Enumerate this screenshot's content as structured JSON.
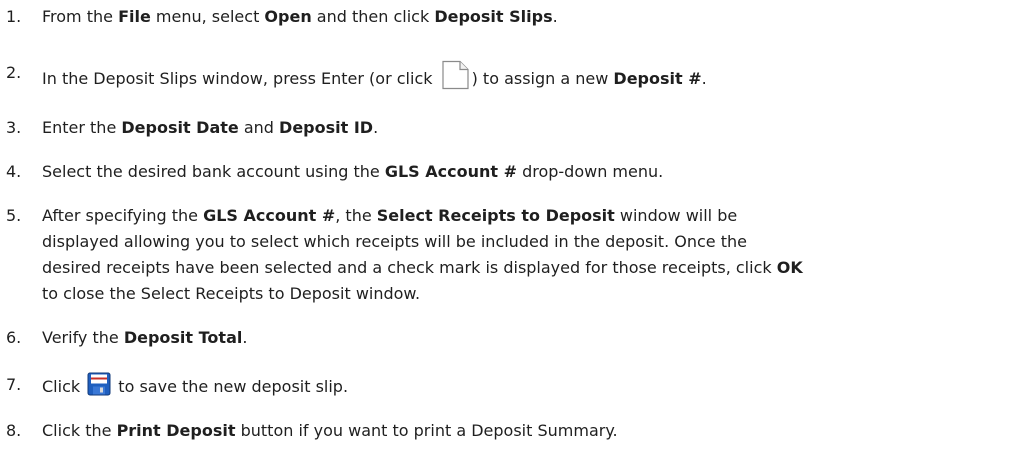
{
  "steps": [
    {
      "number": "1.",
      "t1": "From the ",
      "b1": "File",
      "t2": " menu, select ",
      "b2": "Open",
      "t3": " and then click ",
      "b3": "Deposit Slips",
      "t4": "."
    },
    {
      "number": "2.",
      "t1": "In the Deposit Slips window, press Enter (or click ",
      "icon": "new-document-icon",
      "t2": ") to assign a new ",
      "b1": "Deposit #",
      "t3": "."
    },
    {
      "number": "3.",
      "t1": "Enter the ",
      "b1": "Deposit Date",
      "t2": " and ",
      "b2": "Deposit ID",
      "t3": "."
    },
    {
      "number": "4.",
      "t1": "Select the desired bank account using the ",
      "b1": "GLS Account #",
      "t2": " drop-down menu."
    },
    {
      "number": "5.",
      "l1a": "After specifying the ",
      "l1b": "GLS Account #",
      "l1c": ", the ",
      "l1d": "Select Receipts to Deposit",
      "l1e": " window will be",
      "l2": "displayed allowing you to select which receipts will be included in the deposit. Once the",
      "l3a": "desired receipts have been selected and a check mark is displayed for those receipts, click ",
      "l3b": "OK",
      "l4": "to close the Select Receipts to Deposit window."
    },
    {
      "number": "6.",
      "t1": "Verify the ",
      "b1": "Deposit Total",
      "t2": "."
    },
    {
      "number": "7.",
      "t1": "Click ",
      "icon": "save-icon",
      "t2": " to save the new deposit slip."
    },
    {
      "number": "8.",
      "t1": "Click the ",
      "b1": "Print Deposit",
      "t2": " button if you want to print a Deposit Summary."
    }
  ],
  "colors": {
    "text": "#1f1f1f",
    "save_icon_blue": "#1f5fbf",
    "save_icon_red": "#c8302a"
  }
}
